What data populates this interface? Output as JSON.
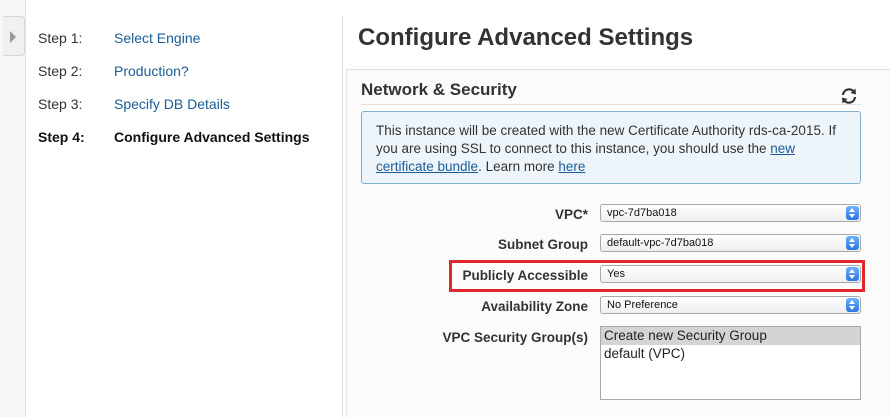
{
  "steps": [
    {
      "num": "Step 1:",
      "label": "Select Engine"
    },
    {
      "num": "Step 2:",
      "label": "Production?"
    },
    {
      "num": "Step 3:",
      "label": "Specify DB Details"
    },
    {
      "num": "Step 4:",
      "label": "Configure Advanced Settings"
    }
  ],
  "page_title": "Configure Advanced Settings",
  "section": {
    "title": "Network & Security",
    "refresh_icon": "refresh-icon"
  },
  "info": {
    "text_before": "This instance will be created with the new Certificate Authority rds-ca-2015. If you are using SSL to connect to this instance, you should use the ",
    "link1": "new certificate bundle",
    "text_middle": ". Learn more ",
    "link2": "here"
  },
  "form": {
    "vpc_label": "VPC*",
    "vpc_value": "vpc-7d7ba018",
    "subnet_label": "Subnet Group",
    "subnet_value": "default-vpc-7d7ba018",
    "public_label": "Publicly Accessible",
    "public_value": "Yes",
    "az_label": "Availability Zone",
    "az_value": "No Preference",
    "sg_label": "VPC Security Group(s)",
    "sg_options": [
      "Create new Security Group",
      "default (VPC)"
    ]
  },
  "colors": {
    "link": "#1a5c97",
    "highlight": "#e2272c",
    "info_border": "#7fb1cf"
  }
}
